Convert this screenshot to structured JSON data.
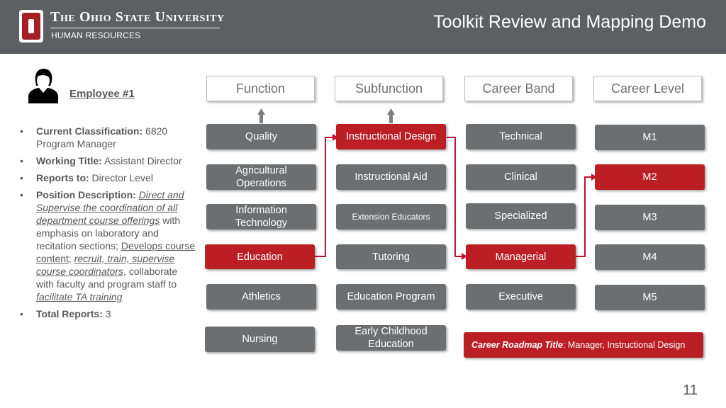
{
  "header": {
    "university_name": "The Ohio State University",
    "department": "HUMAN RESOURCES",
    "slide_title": "Toolkit Review and Mapping Demo",
    "header_color": "#5d6062",
    "logo_color": "#a51f24"
  },
  "employee": {
    "icon": "person-icon",
    "label": "Employee #1",
    "bullets": {
      "classification": {
        "label": "Current Classification:",
        "value": " 6820 Program Manager"
      },
      "working_title": {
        "label": "Working Title:",
        "value": " Assistant Director"
      },
      "reports_to": {
        "label": "Reports to:",
        "value": " Director Level"
      },
      "position_description": {
        "label": "Position Description:",
        "part1": "Direct and Supervise the coordination of all department course offerings",
        "part2": " with emphasis on laboratory and recitation sections; ",
        "part3": "Develops course content;",
        "part4": " ",
        "part5": "recruit, train, supervise course coordinators",
        "part6": ", collaborate with faculty and program staff to ",
        "part7": "facilitate TA training"
      },
      "total_reports": {
        "label": "Total Reports:",
        "value": " 3"
      }
    }
  },
  "columns": {
    "function": "Function",
    "subfunction": "Subfunction",
    "career_band": "Career Band",
    "career_level": "Career Level"
  },
  "function_items": [
    "Quality",
    "Agricultural Operations",
    "Information Technology",
    "Education",
    "Athletics",
    "Nursing"
  ],
  "subfunction_items": [
    "Instructional Design",
    "Instructional Aid",
    "Extension Educators",
    "Tutoring",
    "Education Program",
    "Early Childhood Education"
  ],
  "career_band_items": [
    "Technical",
    "Clinical",
    "Specialized",
    "Managerial",
    "Executive"
  ],
  "career_level_items": [
    "M1",
    "M2",
    "M3",
    "M4",
    "M5"
  ],
  "selected": {
    "function": "Education",
    "subfunction": "Instructional Design",
    "career_band": "Managerial",
    "career_level": "M2"
  },
  "roadmap": {
    "label": "Career Roadmap Title",
    "value": ": Manager, Instructional Design"
  },
  "colors": {
    "box_gray": "#6d6e70",
    "selected_red": "#bb1e23",
    "connector_red": "#c8102e",
    "arrow_gray": "#7f7f7f"
  },
  "page_number": "11"
}
